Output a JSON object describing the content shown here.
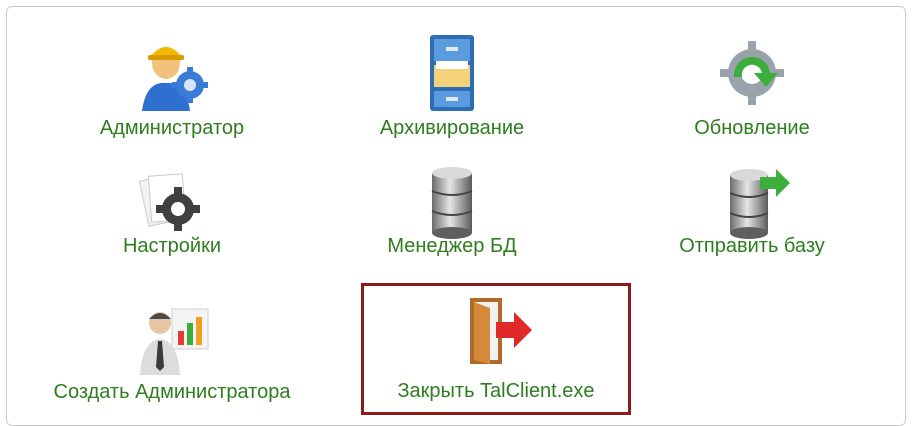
{
  "accent_label_color": "#2e7d1e",
  "selection_color": "#8b1a1a",
  "tiles": [
    {
      "label": "Администратор",
      "icon": "admin-user-gear-icon"
    },
    {
      "label": "Архивирование",
      "icon": "file-cabinet-icon"
    },
    {
      "label": "Обновление",
      "icon": "update-gear-arrow-icon"
    },
    {
      "label": "Настройки",
      "icon": "settings-gear-icon"
    },
    {
      "label": "Менеджер БД",
      "icon": "database-icon"
    },
    {
      "label": "Отправить базу",
      "icon": "database-send-icon"
    },
    {
      "label": "Создать Администратора",
      "icon": "create-admin-chart-icon"
    },
    {
      "label": "Закрыть TalClient.exe",
      "icon": "exit-door-icon",
      "selected": true
    }
  ]
}
